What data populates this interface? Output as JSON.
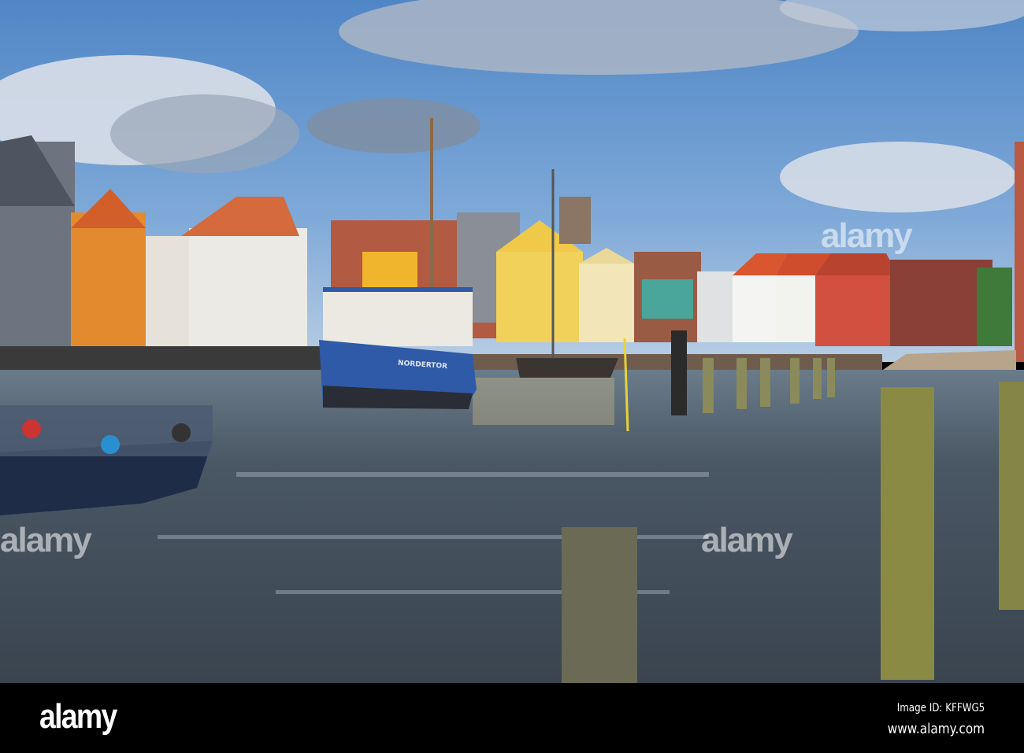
{
  "photo": {
    "subject": "harbour",
    "ship_name": "NORDERTOR",
    "watermark": "alamy"
  },
  "footer": {
    "logo": "alamy",
    "image_id": "Image ID: KFFWG5",
    "url": "www.alamy.com"
  }
}
